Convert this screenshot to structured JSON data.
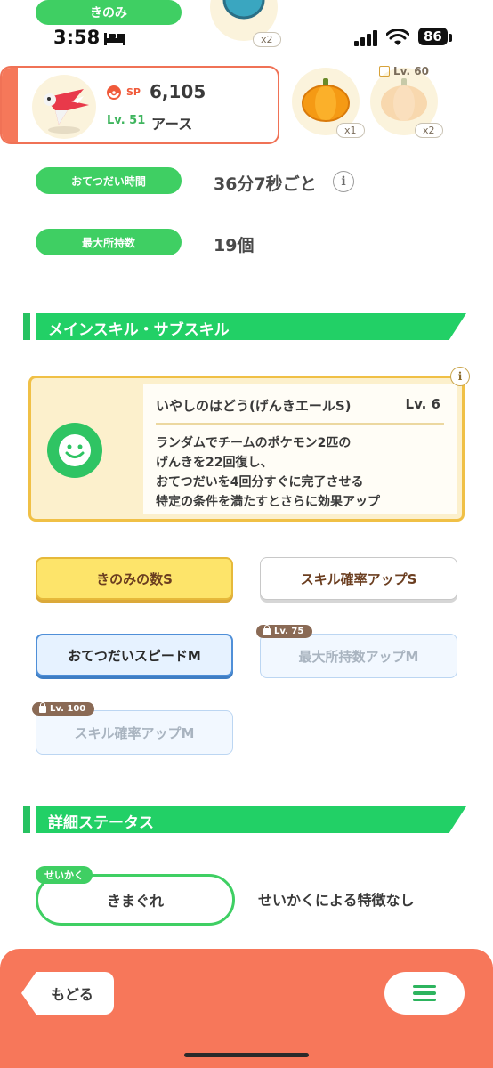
{
  "top_strip": {
    "category_label": "きのみ",
    "top_item_qty": "x2"
  },
  "status_bar": {
    "time": "3:58",
    "battery": "86"
  },
  "pokemon": {
    "sp_label": "SP",
    "sp_value": "6,105",
    "level_label": "Lv. 51",
    "name": "アース"
  },
  "items": [
    {
      "icon": "pumpkin-icon",
      "qty": "x1",
      "locked": false
    },
    {
      "icon": "pumpkin-icon",
      "qty": "x2",
      "locked": true,
      "lock_level": "Lv. 60"
    }
  ],
  "stats": [
    {
      "label": "おてつだい時間",
      "value": "36分7秒ごと",
      "has_info": true
    },
    {
      "label": "最大所持数",
      "value": "19個",
      "has_info": false
    }
  ],
  "skills_section": {
    "title": "メインスキル・サブスキル"
  },
  "main_skill": {
    "name": "いやしのはどう(げんきエールS)",
    "level": "Lv. 6",
    "description": [
      "ランダムでチームのポケモン2匹の",
      "げんきを22回復し、",
      "おてつだいを4回分すぐに完了させる",
      "特定の条件を満たすとさらに効果アップ"
    ]
  },
  "sub_skills": [
    {
      "label": "きのみの数S",
      "style": "gold",
      "lock": ""
    },
    {
      "label": "スキル確率アップS",
      "style": "white",
      "lock": ""
    },
    {
      "label": "おてつだいスピードM",
      "style": "blue",
      "lock": ""
    },
    {
      "label": "最大所持数アップM",
      "style": "locked",
      "lock": "Lv. 75"
    },
    {
      "label": "スキル確率アップM",
      "style": "locked",
      "lock": "Lv. 100"
    }
  ],
  "details_section": {
    "title": "詳細ステータス"
  },
  "nature": {
    "tag": "せいかく",
    "value": "きまぐれ",
    "effect": "せいかくによる特徴なし"
  },
  "bottom": {
    "back_label": "もどる",
    "menu_icon": "hamburger-icon"
  },
  "colors": {
    "green": "#3fcf63",
    "section_green": "#22d066",
    "coral": "#f7775a",
    "gold": "#fde46a",
    "blue_border": "#4f8fd8"
  }
}
